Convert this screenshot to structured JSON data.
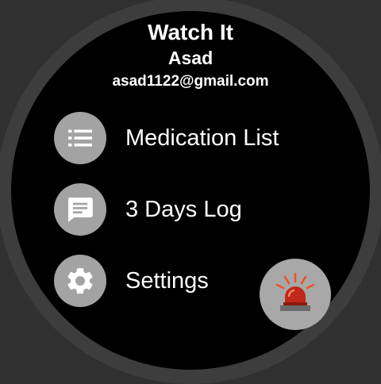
{
  "app": {
    "title": "Watch It"
  },
  "user": {
    "name": "Asad",
    "email": "asad1122@gmail.com"
  },
  "menu": {
    "items": [
      {
        "label": "Medication List",
        "icon": "list-icon"
      },
      {
        "label": "3 Days Log",
        "icon": "message-icon"
      },
      {
        "label": "Settings",
        "icon": "gear-icon"
      }
    ]
  },
  "alarm": {
    "icon": "emergency-siren-icon"
  },
  "colors": {
    "background": "#000000",
    "bezel": "#303030",
    "icon_circle": "#a3a3a3",
    "siren_red": "#c0281a",
    "text": "#ffffff"
  }
}
